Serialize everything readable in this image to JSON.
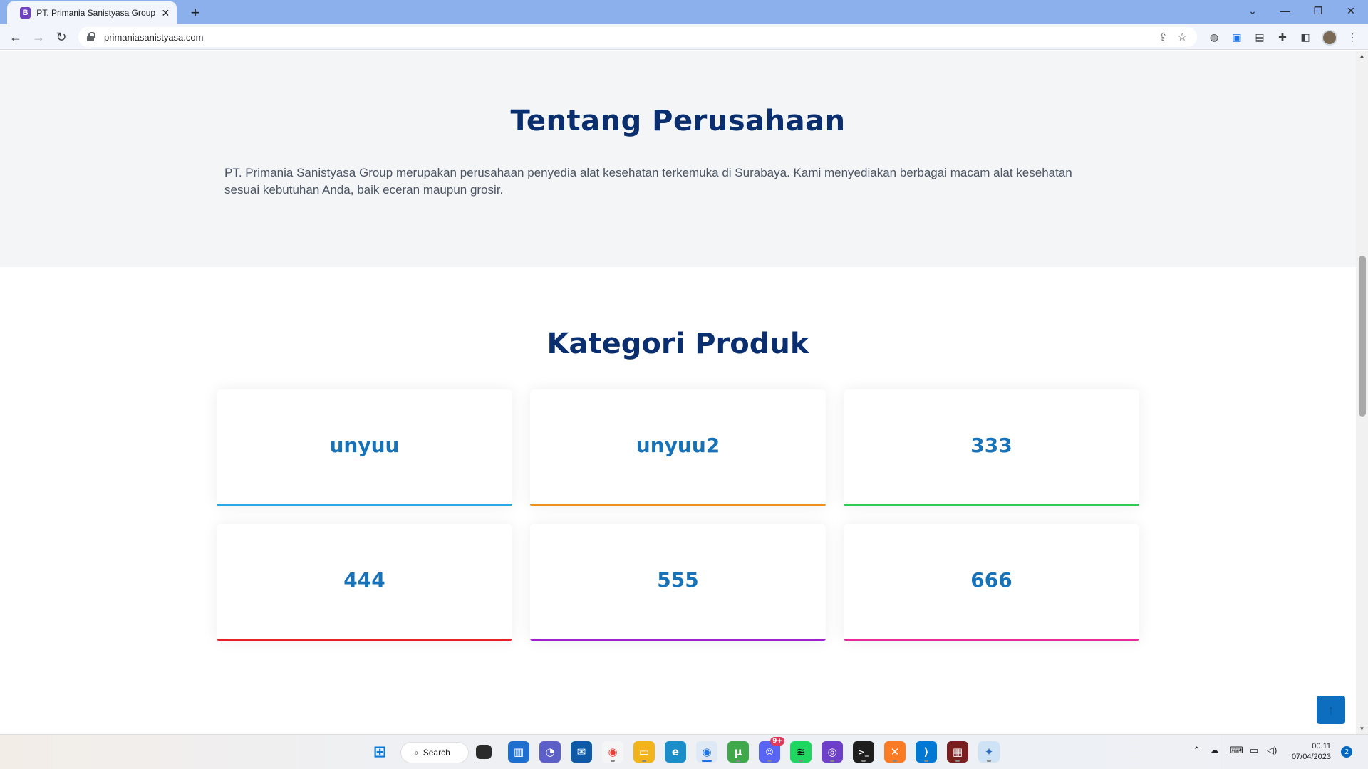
{
  "browser": {
    "tab_title": "PT. Primania Sanistyasa Group - S",
    "tab_favicon_letter": "B",
    "url": "primaniasanistyasa.com"
  },
  "about": {
    "title": "Tentang Perusahaan",
    "text": "PT. Primania Sanistyasa Group merupakan perusahaan penyedia alat kesehatan terkemuka di Surabaya. Kami menyediakan berbagai macam alat kesehatan sesuai kebutuhan Anda, baik eceran maupun grosir."
  },
  "categories": {
    "title": "Kategori Produk",
    "items": [
      {
        "label": "unyuu",
        "accent": "#2aa7e6"
      },
      {
        "label": "unyuu2",
        "accent": "#f0901c"
      },
      {
        "label": "333",
        "accent": "#2ecc52"
      },
      {
        "label": "444",
        "accent": "#e8202a"
      },
      {
        "label": "555",
        "accent": "#a020d0"
      },
      {
        "label": "666",
        "accent": "#e62a9a"
      }
    ]
  },
  "taskbar": {
    "search_label": "Search",
    "time": "00.11",
    "date": "07/04/2023",
    "notification_count": "2",
    "discord_badge": "9+"
  }
}
